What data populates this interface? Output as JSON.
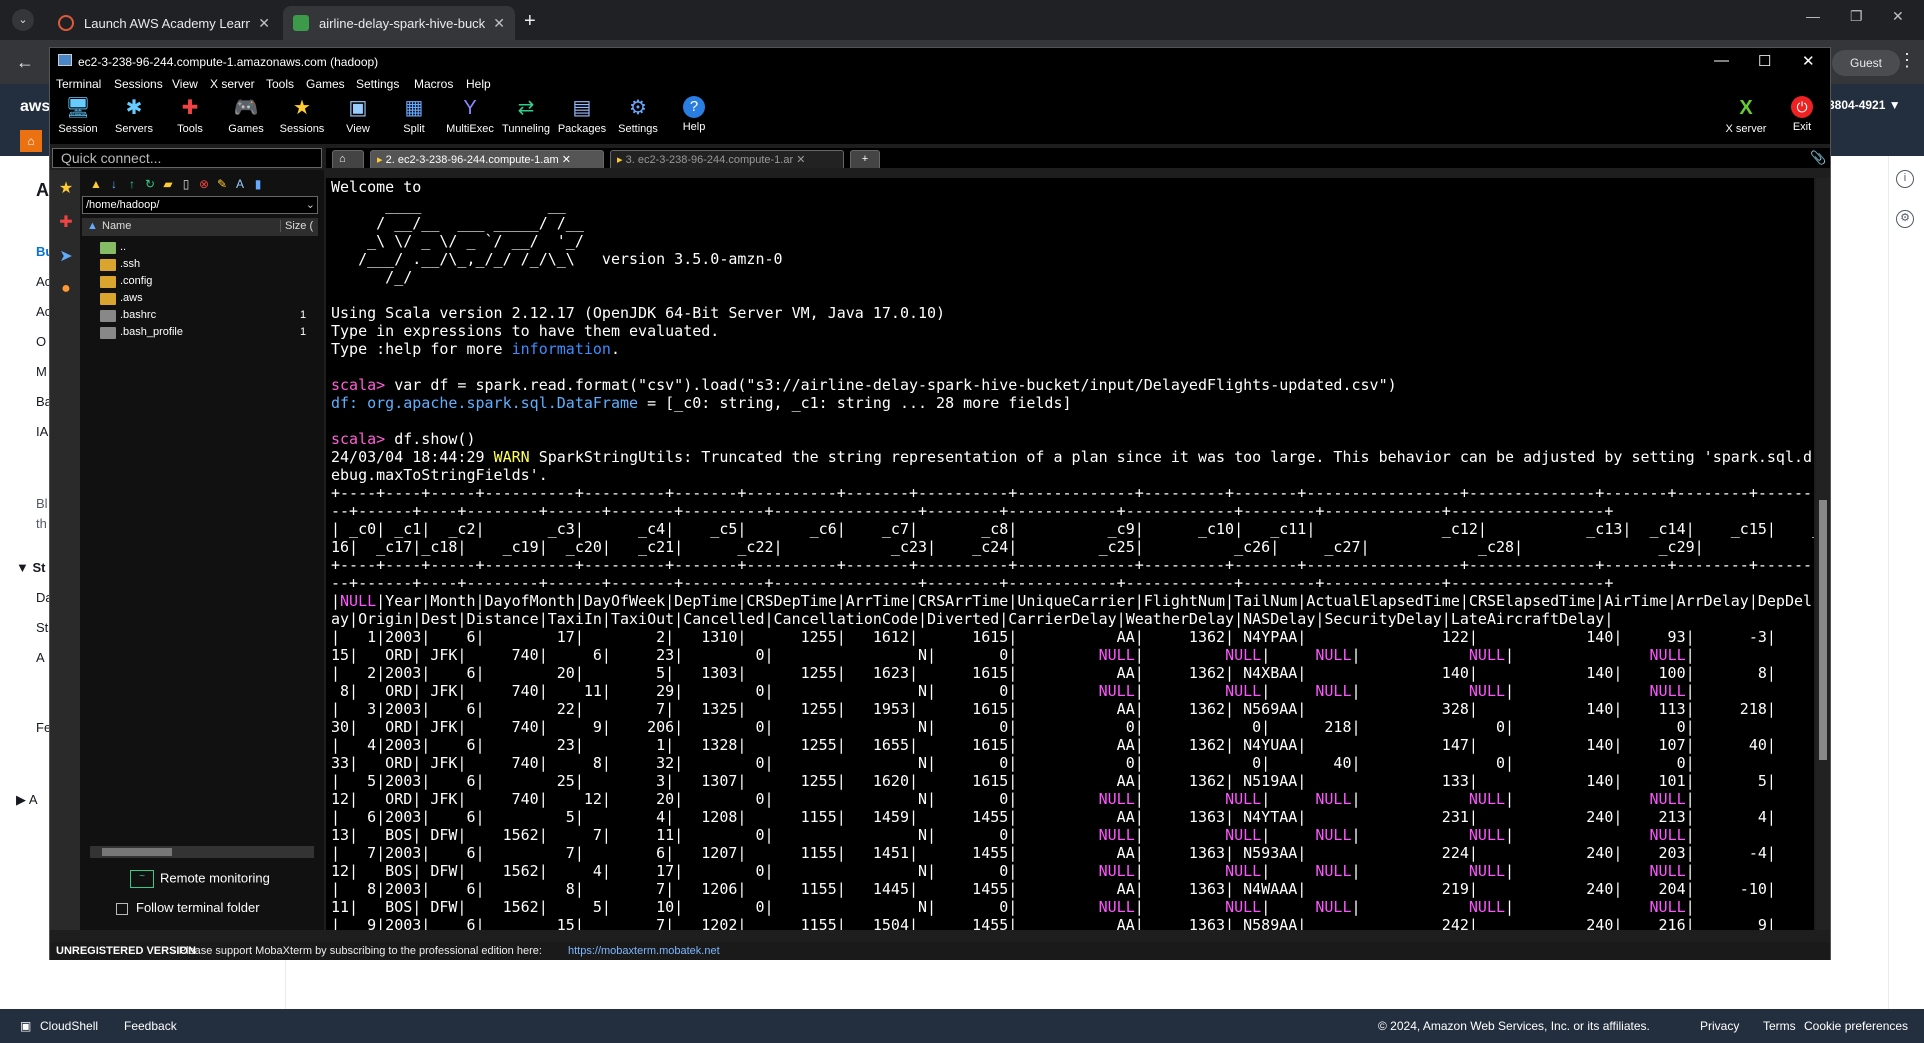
{
  "browser": {
    "tabs": [
      {
        "title": "Launch AWS Academy Learner L",
        "active": false
      },
      {
        "title": "airline-delay-spark-hive-bucket",
        "active": true
      }
    ],
    "profile": "Guest"
  },
  "aws": {
    "account_fragment": "3804-4921 ▼",
    "sidebar_letters": [
      "A",
      "Bu",
      "Ac",
      "Ac",
      "O",
      "M",
      "Ba",
      "IA",
      "Bl",
      "th",
      "St",
      "Da",
      "St",
      "A",
      "Fe",
      "A"
    ],
    "footer": {
      "cloudshell": "CloudShell",
      "feedback": "Feedback",
      "copyright": "© 2024, Amazon Web Services, Inc. or its affiliates.",
      "privacy": "Privacy",
      "terms": "Terms",
      "cookies": "Cookie preferences"
    }
  },
  "moba": {
    "title": "ec2-3-238-96-244.compute-1.amazonaws.com (hadoop)",
    "menu": [
      "Terminal",
      "Sessions",
      "View",
      "X server",
      "Tools",
      "Games",
      "Settings",
      "Macros",
      "Help"
    ],
    "toolbar": [
      "Session",
      "Servers",
      "Tools",
      "Games",
      "Sessions",
      "View",
      "Split",
      "MultiExec",
      "Tunneling",
      "Packages",
      "Settings",
      "Help"
    ],
    "toolbar_right": [
      "X server",
      "Exit"
    ],
    "quick_connect": "Quick connect...",
    "session_tabs": [
      "2. ec2-3-238-96-244.compute-1.am",
      "3. ec2-3-238-96-244.compute-1.ar"
    ],
    "sidebar": {
      "path": "/home/hadoop/",
      "col_name": "Name",
      "col_size": "Size (",
      "files": [
        {
          "name": "..",
          "size": "",
          "type": "up"
        },
        {
          "name": ".ssh",
          "size": "",
          "type": "folder"
        },
        {
          "name": ".config",
          "size": "",
          "type": "folder"
        },
        {
          "name": ".aws",
          "size": "",
          "type": "folder"
        },
        {
          "name": ".bashrc",
          "size": "1",
          "type": "file"
        },
        {
          "name": ".bash_profile",
          "size": "1",
          "type": "file"
        }
      ],
      "remote_monitoring": "Remote monitoring",
      "follow_folder": "Follow terminal folder"
    },
    "status": {
      "version": "UNREGISTERED VERSION",
      "message": "-  Please support MobaXterm by subscribing to the professional edition here:",
      "url": "https://mobaxterm.mobatek.net"
    }
  },
  "terminal": {
    "lines": [
      "Welcome to",
      "      ____              __",
      "     / __/__  ___ _____/ /__",
      "    _\\ \\/ _ \\/ _ `/ __/  '_/",
      "   /___/ .__/\\_,_/_/ /_/\\_\\   version 3.5.0-amzn-0",
      "      /_/",
      "",
      "Using Scala version 2.12.17 (OpenJDK 64-Bit Server VM, Java 17.0.10)",
      "Type in expressions to have them evaluated.",
      "Type :help for more information.",
      "",
      "scala> var df = spark.read.format(\"csv\").load(\"s3://airline-delay-spark-hive-bucket/input/DelayedFlights-updated.csv\")",
      "df: org.apache.spark.sql.DataFrame = [_c0: string, _c1: string ... 28 more fields]",
      "",
      "scala> df.show()",
      "24/03/04 18:44:29 WARN SparkStringUtils: Truncated the string representation of a plan since it was too large. This behavior can be adjusted by setting 'spark.sql.d",
      "ebug.maxToStringFields'.",
      "+----+----+-----+----------+---------+-------+----------+-------+----------+-------------+---------+-------+-----------------+--------------+-------+--------+------",
      "--+------+----+--------+------+-------+---------+----------------+--------+------------+------------+--------+-------------+-----------------+",
      "| _c0| _c1|  _c2|       _c3|      _c4|    _c5|       _c6|    _c7|       _c8|          _c9|      _c10|   _c11|              _c12|           _c13|  _c14|    _c15|    _c",
      "16|  _c17|_c18|    _c19|  _c20|   _c21|      _c22|            _c23|    _c24|         _c25|          _c26|     _c27|            _c28|               _c29|",
      "+----+----+-----+----------+---------+-------+----------+-------+----------+-------------+---------+-------+-----------------+--------------+-------+--------+------",
      "--+------+----+--------+------+-------+---------+----------------+--------+------------+------------+--------+-------------+-----------------+",
      "|NULL|Year|Month|DayofMonth|DayOfWeek|DepTime|CRSDepTime|ArrTime|CRSArrTime|UniqueCarrier|FlightNum|TailNum|ActualElapsedTime|CRSElapsedTime|AirTime|ArrDelay|DepDel",
      "ay|Origin|Dest|Distance|TaxiIn|TaxiOut|Cancelled|CancellationCode|Diverted|CarrierDelay|WeatherDelay|NASDelay|SecurityDelay|LateAircraftDelay|",
      "|   1|2003|    6|        17|        2|   1310|      1255|   1612|      1615|           AA|     1362| N4YPAA|               122|            140|     93|      -3|",
      "15|   ORD| JFK|     740|     6|     23|        0|                N|       0|         NULL|         NULL|     NULL|            NULL|               NULL|",
      "|   2|2003|    6|        20|        5|   1303|      1255|   1623|      1615|           AA|     1362| N4XBAA|               140|            140|    100|       8|",
      " 8|   ORD| JFK|     740|    11|     29|        0|                N|       0|         NULL|         NULL|     NULL|            NULL|               NULL|",
      "|   3|2003|    6|        22|        7|   1325|      1255|   1953|      1615|           AA|     1362| N569AA|               328|            140|    113|     218|",
      "30|   ORD| JFK|     740|     9|    206|        0|                N|       0|            0|            0|      218|               0|                  0|",
      "|   4|2003|    6|        23|        1|   1328|      1255|   1655|      1615|           AA|     1362| N4YUAA|               147|            140|    107|      40|",
      "33|   ORD| JFK|     740|     8|     32|        0|                N|       0|            0|            0|       40|               0|                  0|",
      "|   5|2003|    6|        25|        3|   1307|      1255|   1620|      1615|           AA|     1362| N519AA|               133|            140|    101|       5|",
      "12|   ORD| JFK|     740|    12|     20|        0|                N|       0|         NULL|         NULL|     NULL|            NULL|               NULL|",
      "|   6|2003|    6|         5|        4|   1208|      1155|   1459|      1455|           AA|     1363| N4YTAA|               231|            240|    213|       4|",
      "13|   BOS| DFW|    1562|     7|     11|        0|                N|       0|         NULL|         NULL|     NULL|            NULL|               NULL|",
      "|   7|2003|    6|         7|        6|   1207|      1155|   1451|      1455|           AA|     1363| N593AA|               224|            240|    203|      -4|",
      "12|   BOS| DFW|    1562|     4|     17|        0|                N|       0|         NULL|         NULL|     NULL|            NULL|               NULL|",
      "|   8|2003|    6|         8|        7|   1206|      1155|   1445|      1455|           AA|     1363| N4WAAA|               219|            240|    204|     -10|",
      "11|   BOS| DFW|    1562|     5|     10|        0|                N|       0|         NULL|         NULL|     NULL|            NULL|               NULL|",
      "|   9|2003|    6|        15|        7|   1202|      1155|   1504|      1455|           AA|     1363| N589AA|               242|            240|    216|       9|"
    ],
    "colors": {
      "prompt": "#ff5fd7",
      "info": "#3a8eff",
      "warn": "#ffff55",
      "type": "#5fafff",
      "null": "#ff55ff"
    }
  }
}
